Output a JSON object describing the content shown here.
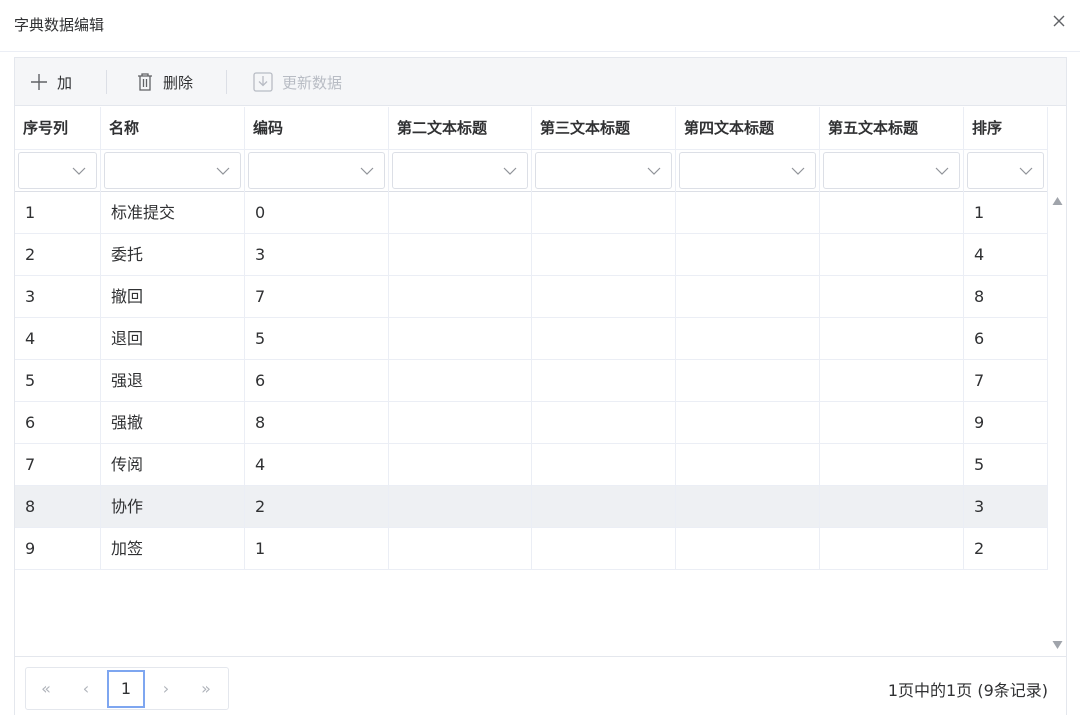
{
  "dialog": {
    "title": "字典数据编辑"
  },
  "toolbar": {
    "add": "加",
    "delete": "删除",
    "update": "更新数据"
  },
  "columns": [
    "序号列",
    "名称",
    "编码",
    "第二文本标题",
    "第三文本标题",
    "第四文本标题",
    "第五文本标题",
    "排序"
  ],
  "rows": [
    [
      "1",
      "标准提交",
      "0",
      "",
      "",
      "",
      "",
      "1"
    ],
    [
      "2",
      "委托",
      "3",
      "",
      "",
      "",
      "",
      "4"
    ],
    [
      "3",
      "撤回",
      "7",
      "",
      "",
      "",
      "",
      "8"
    ],
    [
      "4",
      "退回",
      "5",
      "",
      "",
      "",
      "",
      "6"
    ],
    [
      "5",
      "强退",
      "6",
      "",
      "",
      "",
      "",
      "7"
    ],
    [
      "6",
      "强撤",
      "8",
      "",
      "",
      "",
      "",
      "9"
    ],
    [
      "7",
      "传阅",
      "4",
      "",
      "",
      "",
      "",
      "5"
    ],
    [
      "8",
      "协作",
      "2",
      "",
      "",
      "",
      "",
      "3"
    ],
    [
      "9",
      "加签",
      "1",
      "",
      "",
      "",
      "",
      "2"
    ]
  ],
  "selected_row": 8,
  "pager": {
    "first": "«",
    "prev": "‹",
    "current": "1",
    "next": "›",
    "last": "»"
  },
  "page_info": "1页中的1页  (9条记录)",
  "icons": {
    "close": "close-icon",
    "add": "plus-icon",
    "delete": "trash-icon",
    "update": "download-icon",
    "dropdown": "chevron-down-icon"
  }
}
